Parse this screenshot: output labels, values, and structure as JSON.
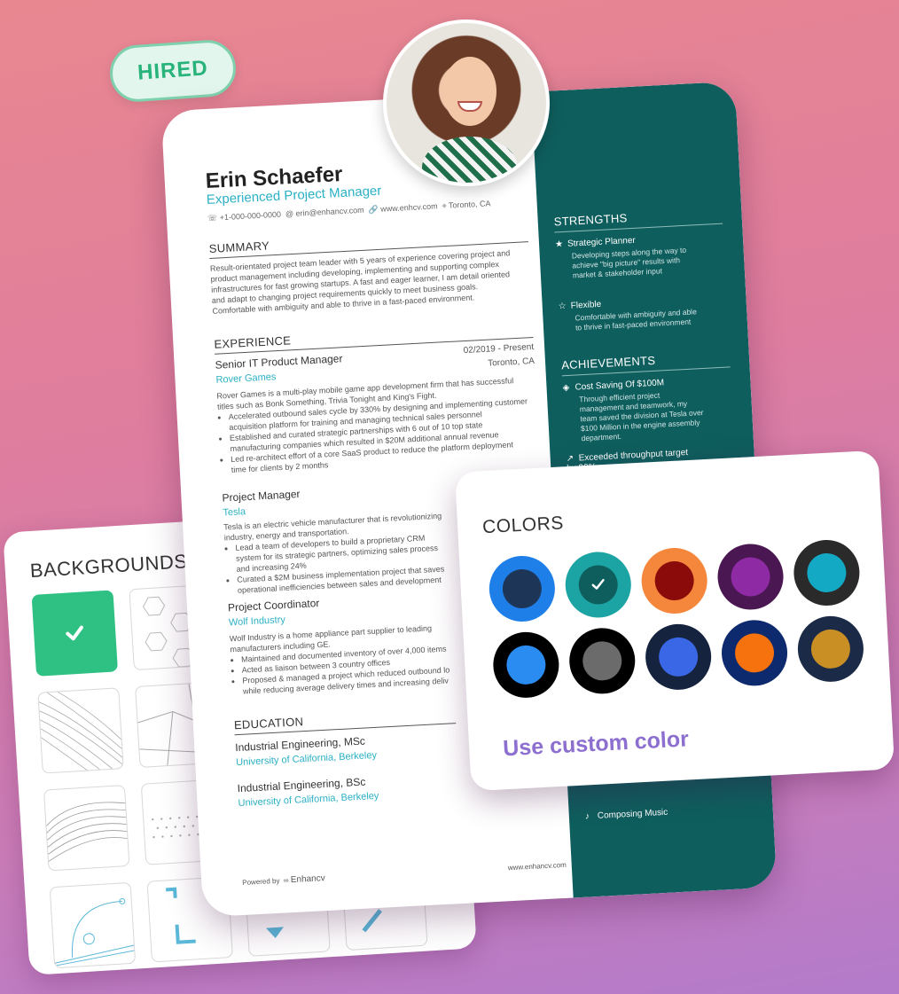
{
  "badge": {
    "label": "HIRED"
  },
  "backgrounds": {
    "title": "BACKGROUNDS"
  },
  "resume": {
    "name": "Erin Schaefer",
    "role": "Experienced Project Manager",
    "contact": {
      "phone": "+1-000-000-0000",
      "email": "erin@enhancv.com",
      "website": "www.enhcv.com",
      "location": "Toronto, CA"
    },
    "summary": {
      "heading": "SUMMARY",
      "text": "Result-orientated project team leader with 5 years of experience covering project and product management including developing, implementing and supporting complex infrastructures for fast growing startups. A fast and eager learner, I am detail oriented and adapt to changing project requirements quickly to meet business goals. Comfortable with ambiguity and able to thrive in a fast-paced environment."
    },
    "experience": {
      "heading": "EXPERIENCE",
      "jobs": [
        {
          "title": "Senior IT Product Manager",
          "company": "Rover Games",
          "dates": "02/2019 - Present",
          "location": "Toronto, CA",
          "description": "Rover Games is a multi-play mobile game app development firm that has successful titles such as Bonk Something, Trivia Tonight and King's Fight.",
          "bullets": [
            "Accelerated outbound sales cycle by 330% by designing and implementing customer acquisition platform for training and managing technical sales personnel",
            "Established and curated strategic partnerships with 6 out of 10 top state manufacturing companies which resulted in $20M additional annual revenue",
            "Led re-architect effort of a core SaaS product to reduce the platform deployment time for clients by 2 months"
          ]
        },
        {
          "title": "Project Manager",
          "company": "Tesla",
          "description": "Tesla is an electric vehicle manufacturer that is revolutionizing industry, energy and transportation.",
          "bullets": [
            "Lead a team of developers to build a proprietary CRM system for its strategic partners, optimizing sales process and increasing 24%",
            "Curated a $2M business implementation project that saves operational inefficiencies between sales and development"
          ]
        },
        {
          "title": "Project Coordinator",
          "company": "Wolf Industry",
          "description": "Wolf Industry is a home appliance part supplier to leading manufacturers including GE.",
          "bullets": [
            "Maintained and documented inventory of over 4,000 items",
            "Acted as liaison between 3 country offices",
            "Proposed & managed a project which reduced outbound lo while reducing average delivery times and increasing deliv"
          ]
        }
      ]
    },
    "education": {
      "heading": "EDUCATION",
      "items": [
        {
          "degree": "Industrial Engineering, MSc",
          "school": "University of California, Berkeley"
        },
        {
          "degree": "Industrial Engineering, BSc",
          "school": "University of California, Berkeley"
        }
      ]
    },
    "footer": {
      "powered": "Powered by",
      "brand": "Enhancv",
      "site": "www.enhancv.com"
    },
    "sidebar": {
      "strengths_heading": "STRENGTHS",
      "strengths": [
        {
          "title": "Strategic Planner",
          "desc": "Developing steps along the way to achieve \"big picture\" results with market & stakeholder input"
        },
        {
          "title": "Flexible",
          "desc": "Comfortable with ambiguity and able to thrive in fast-paced environment"
        }
      ],
      "achievements_heading": "ACHIEVEMENTS",
      "achievements": [
        {
          "title": "Cost Saving Of $100M",
          "desc": "Through efficient project management and teamwork, my team saved the division at Tesla over $100 Million in the engine assembly department."
        },
        {
          "title": "Exceeded throughput target by 90%",
          "desc": ""
        }
      ],
      "interest": "Composing Music"
    }
  },
  "colors": {
    "title": "COLORS",
    "custom_label": "Use custom color",
    "swatches": [
      {
        "outer": "#1f7fe8",
        "inner": "#1d3557",
        "selected": false
      },
      {
        "outer": "#1ca3a3",
        "inner": "#0f5e5e",
        "selected": true
      },
      {
        "outer": "#f5873c",
        "inner": "#8b0a0a",
        "selected": false
      },
      {
        "outer": "#4a1752",
        "inner": "#8e2aa3",
        "selected": false
      },
      {
        "outer": "#2a2a2a",
        "inner": "#13a9c4",
        "selected": false
      },
      {
        "outer": "#000000",
        "inner": "#2a8cf0",
        "selected": false
      },
      {
        "outer": "#000000",
        "inner": "#6b6b6b",
        "selected": false
      },
      {
        "outer": "#15233f",
        "inner": "#3a67e6",
        "selected": false
      },
      {
        "outer": "#0e2a6e",
        "inner": "#f5720e",
        "selected": false
      },
      {
        "outer": "#1b2b47",
        "inner": "#c98f24",
        "selected": false
      }
    ]
  }
}
